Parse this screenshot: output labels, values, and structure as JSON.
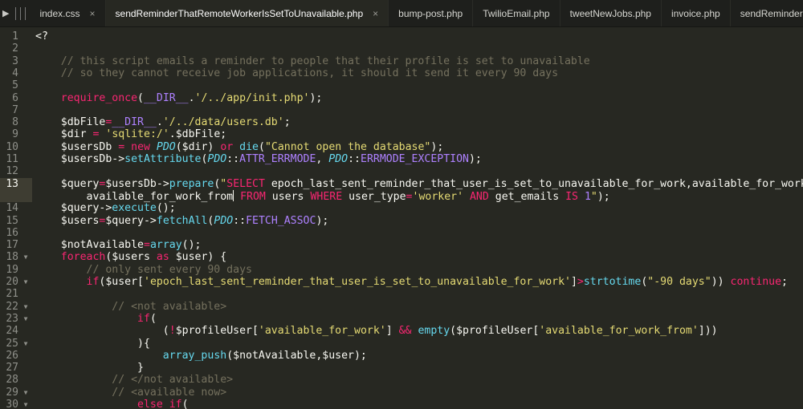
{
  "tabs": [
    {
      "label": "index.css",
      "active": false,
      "closable": true
    },
    {
      "label": "sendReminderThatRemoteWorkerIsSetToUnavailable.php",
      "active": true,
      "closable": true
    },
    {
      "label": "bump-post.php",
      "active": false,
      "closable": false
    },
    {
      "label": "TwilioEmail.php",
      "active": false,
      "closable": false
    },
    {
      "label": "tweetNewJobs.php",
      "active": false,
      "closable": false
    },
    {
      "label": "invoice.php",
      "active": false,
      "closable": false
    },
    {
      "label": "sendReminderThatJobAutoBumpSc",
      "active": false,
      "closable": false
    }
  ],
  "close_glyph": "×",
  "play_glyph": "▶",
  "current_line": "13",
  "gutter": [
    {
      "n": "1",
      "fold": ""
    },
    {
      "n": "2",
      "fold": ""
    },
    {
      "n": "3",
      "fold": ""
    },
    {
      "n": "4",
      "fold": ""
    },
    {
      "n": "5",
      "fold": ""
    },
    {
      "n": "6",
      "fold": ""
    },
    {
      "n": "7",
      "fold": ""
    },
    {
      "n": "8",
      "fold": ""
    },
    {
      "n": "9",
      "fold": ""
    },
    {
      "n": "10",
      "fold": ""
    },
    {
      "n": "11",
      "fold": ""
    },
    {
      "n": "12",
      "fold": ""
    },
    {
      "n": "13",
      "fold": ""
    },
    {
      "n": "",
      "fold": ""
    },
    {
      "n": "14",
      "fold": ""
    },
    {
      "n": "15",
      "fold": ""
    },
    {
      "n": "16",
      "fold": ""
    },
    {
      "n": "17",
      "fold": ""
    },
    {
      "n": "18",
      "fold": "▼"
    },
    {
      "n": "19",
      "fold": ""
    },
    {
      "n": "20",
      "fold": "▼"
    },
    {
      "n": "21",
      "fold": ""
    },
    {
      "n": "22",
      "fold": "▼"
    },
    {
      "n": "23",
      "fold": "▼"
    },
    {
      "n": "24",
      "fold": ""
    },
    {
      "n": "25",
      "fold": "▼"
    },
    {
      "n": "26",
      "fold": ""
    },
    {
      "n": "27",
      "fold": ""
    },
    {
      "n": "28",
      "fold": ""
    },
    {
      "n": "29",
      "fold": "▼"
    },
    {
      "n": "30",
      "fold": "▼"
    }
  ],
  "code_lines": [
    [
      [
        "t",
        "<?"
      ]
    ],
    [],
    [
      [
        "cm",
        "    // this script emails a reminder to people that their profile is set to unavailable"
      ]
    ],
    [
      [
        "cm",
        "    // so they cannot receive job applications, it should it send it every 90 days"
      ]
    ],
    [],
    [
      [
        "t",
        "    "
      ],
      [
        "kw",
        "require_once"
      ],
      [
        "t",
        "("
      ],
      [
        "const",
        "__DIR__"
      ],
      [
        "t",
        "."
      ],
      [
        "str",
        "'/../app/init.php'"
      ],
      [
        "t",
        ");"
      ]
    ],
    [],
    [
      [
        "t",
        "    $dbFile"
      ],
      [
        "op",
        "="
      ],
      [
        "const",
        "__DIR__"
      ],
      [
        "t",
        "."
      ],
      [
        "str",
        "'/../data/users.db'"
      ],
      [
        "t",
        ";"
      ]
    ],
    [
      [
        "t",
        "    $dir "
      ],
      [
        "op",
        "="
      ],
      [
        "t",
        " "
      ],
      [
        "str",
        "'sqlite:/'"
      ],
      [
        "t",
        ".$dbFile;"
      ]
    ],
    [
      [
        "t",
        "    $usersDb "
      ],
      [
        "op",
        "="
      ],
      [
        "t",
        " "
      ],
      [
        "kw",
        "new"
      ],
      [
        "t",
        " "
      ],
      [
        "cls",
        "PDO"
      ],
      [
        "t",
        "($dir) "
      ],
      [
        "kw",
        "or"
      ],
      [
        "t",
        " "
      ],
      [
        "fn",
        "die"
      ],
      [
        "t",
        "("
      ],
      [
        "str",
        "\"Cannot open the database\""
      ],
      [
        "t",
        ");"
      ]
    ],
    [
      [
        "t",
        "    $usersDb->"
      ],
      [
        "fn",
        "setAttribute"
      ],
      [
        "t",
        "("
      ],
      [
        "cls",
        "PDO"
      ],
      [
        "t",
        "::"
      ],
      [
        "const",
        "ATTR_ERRMODE"
      ],
      [
        "t",
        ", "
      ],
      [
        "cls",
        "PDO"
      ],
      [
        "t",
        "::"
      ],
      [
        "const",
        "ERRMODE_EXCEPTION"
      ],
      [
        "t",
        ");"
      ]
    ],
    [],
    [
      [
        "t",
        "    $query"
      ],
      [
        "op",
        "="
      ],
      [
        "t",
        "$usersDb->"
      ],
      [
        "fn",
        "prepare"
      ],
      [
        "t",
        "("
      ],
      [
        "str",
        "\""
      ],
      [
        "kw",
        "SELECT"
      ],
      [
        "t",
        " epoch_last_sent_reminder_that_user_is_set_to_unavailable_for_work,available_for_work,"
      ]
    ],
    [
      [
        "t",
        "        available_for_work_from"
      ],
      [
        "cursor",
        ""
      ],
      [
        "t",
        " "
      ],
      [
        "kw",
        "FROM"
      ],
      [
        "t",
        " users "
      ],
      [
        "kw",
        "WHERE"
      ],
      [
        "t",
        " user_type"
      ],
      [
        "op",
        "="
      ],
      [
        "str",
        "'worker'"
      ],
      [
        "t",
        " "
      ],
      [
        "kw",
        "AND"
      ],
      [
        "t",
        " get_emails "
      ],
      [
        "kw",
        "IS"
      ],
      [
        "t",
        " "
      ],
      [
        "const",
        "1"
      ],
      [
        "str",
        "\""
      ],
      [
        "t",
        ");"
      ]
    ],
    [
      [
        "t",
        "    $query->"
      ],
      [
        "fn",
        "execute"
      ],
      [
        "t",
        "();"
      ]
    ],
    [
      [
        "t",
        "    $users"
      ],
      [
        "op",
        "="
      ],
      [
        "t",
        "$query->"
      ],
      [
        "fn",
        "fetchAll"
      ],
      [
        "t",
        "("
      ],
      [
        "cls",
        "PDO"
      ],
      [
        "t",
        "::"
      ],
      [
        "const",
        "FETCH_ASSOC"
      ],
      [
        "t",
        ");"
      ]
    ],
    [],
    [
      [
        "t",
        "    $notAvailable"
      ],
      [
        "op",
        "="
      ],
      [
        "fn",
        "array"
      ],
      [
        "t",
        "();"
      ]
    ],
    [
      [
        "t",
        "    "
      ],
      [
        "kw",
        "foreach"
      ],
      [
        "t",
        "($users "
      ],
      [
        "kw",
        "as"
      ],
      [
        "t",
        " $user) {"
      ]
    ],
    [
      [
        "cm",
        "        // only sent every 90 days"
      ]
    ],
    [
      [
        "t",
        "        "
      ],
      [
        "kw",
        "if"
      ],
      [
        "t",
        "($user["
      ],
      [
        "str",
        "'epoch_last_sent_reminder_that_user_is_set_to_unavailable_for_work'"
      ],
      [
        "t",
        "]"
      ],
      [
        "op",
        ">"
      ],
      [
        "fn",
        "strtotime"
      ],
      [
        "t",
        "("
      ],
      [
        "str",
        "\"-90 days\""
      ],
      [
        "t",
        ")) "
      ],
      [
        "kw",
        "continue"
      ],
      [
        "t",
        ";"
      ]
    ],
    [],
    [
      [
        "cm",
        "            // <not available>"
      ]
    ],
    [
      [
        "t",
        "                "
      ],
      [
        "kw",
        "if"
      ],
      [
        "t",
        "("
      ]
    ],
    [
      [
        "t",
        "                    ("
      ],
      [
        "op",
        "!"
      ],
      [
        "t",
        "$profileUser["
      ],
      [
        "str",
        "'available_for_work'"
      ],
      [
        "t",
        "] "
      ],
      [
        "op",
        "&&"
      ],
      [
        "t",
        " "
      ],
      [
        "fn",
        "empty"
      ],
      [
        "t",
        "($profileUser["
      ],
      [
        "str",
        "'available_for_work_from'"
      ],
      [
        "t",
        "]))"
      ]
    ],
    [
      [
        "t",
        "                ){"
      ]
    ],
    [
      [
        "t",
        "                    "
      ],
      [
        "fn",
        "array_push"
      ],
      [
        "t",
        "($notAvailable,$user);"
      ]
    ],
    [
      [
        "t",
        "                }"
      ]
    ],
    [
      [
        "cm",
        "            // </not available>"
      ]
    ],
    [
      [
        "cm",
        "            // <available now>"
      ]
    ],
    [
      [
        "t",
        "                "
      ],
      [
        "kw",
        "else if"
      ],
      [
        "t",
        "("
      ]
    ]
  ]
}
